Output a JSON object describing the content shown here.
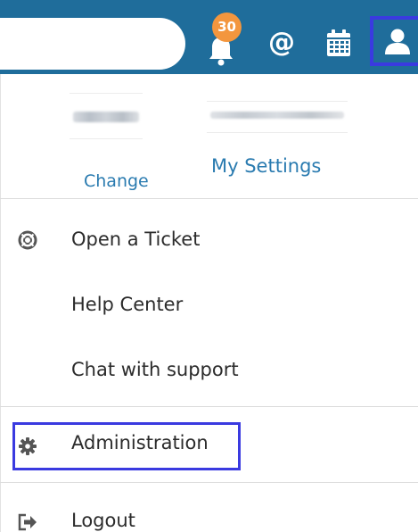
{
  "header": {
    "search_placeholder": "",
    "notification_count": "30",
    "mentions_icon": "at-icon",
    "calendar_icon": "calendar-icon",
    "user_icon": "user-icon",
    "bar_color": "#1f6d9b",
    "badge_color": "#f3963e",
    "highlight_color": "#3a3ae0"
  },
  "profile": {
    "avatar_thumb": "blurred-avatar-image",
    "name_thumb": "blurred-name-image",
    "change_label": "Change",
    "settings_label": "My Settings"
  },
  "menu": {
    "items": [
      {
        "label": "Open a Ticket",
        "icon": "lifebuoy-icon"
      },
      {
        "label": "Help Center",
        "icon": ""
      },
      {
        "label": "Chat with support",
        "icon": ""
      },
      {
        "label": "Administration",
        "icon": "gear-icon"
      },
      {
        "label": "Logout",
        "icon": "logout-icon"
      }
    ]
  }
}
